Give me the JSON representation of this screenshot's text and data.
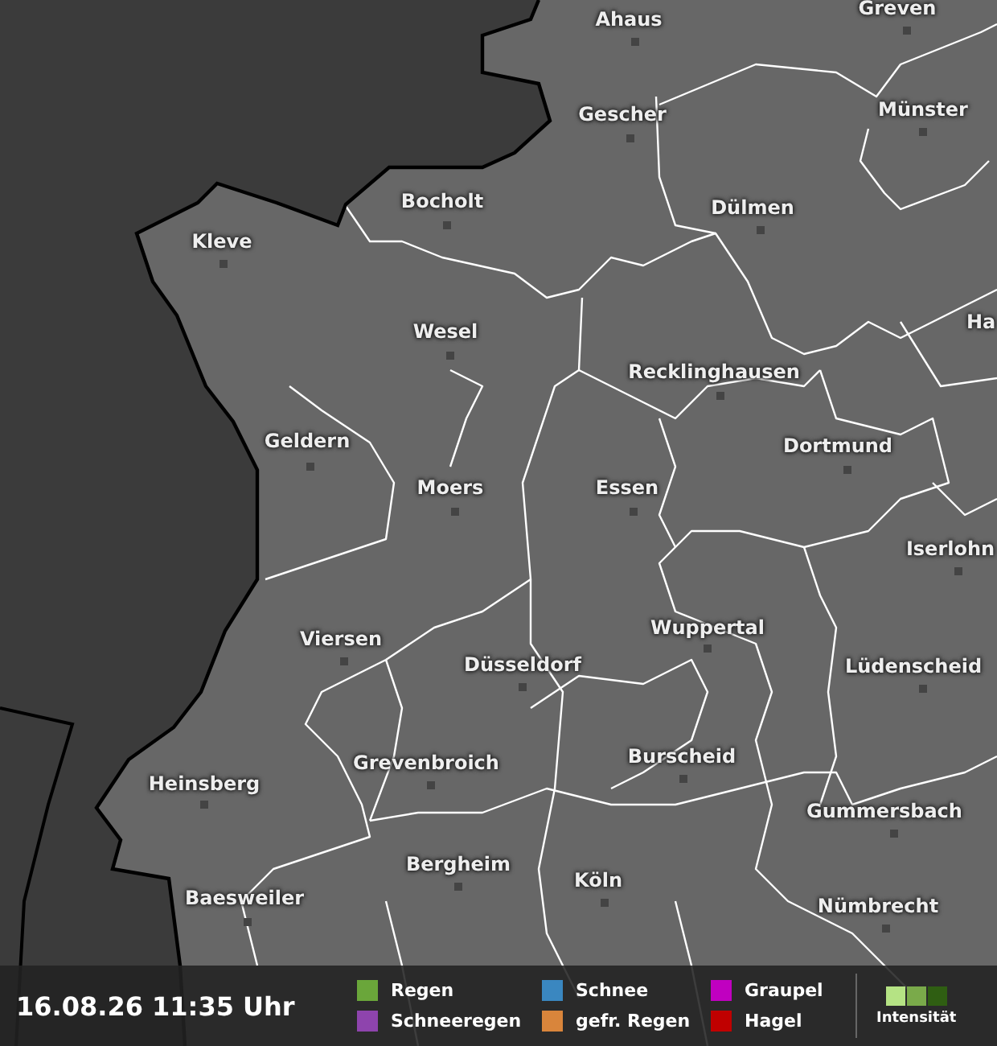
{
  "map": {
    "cities": [
      {
        "name": "Ahaus"
      },
      {
        "name": "Greven"
      },
      {
        "name": "Gescher"
      },
      {
        "name": "Münster"
      },
      {
        "name": "Bocholt"
      },
      {
        "name": "Dülmen"
      },
      {
        "name": "Kleve"
      },
      {
        "name": "Wesel"
      },
      {
        "name": "Ha"
      },
      {
        "name": "Recklinghausen"
      },
      {
        "name": "Geldern"
      },
      {
        "name": "Dortmund"
      },
      {
        "name": "Moers"
      },
      {
        "name": "Essen"
      },
      {
        "name": "Iserlohn"
      },
      {
        "name": "Viersen"
      },
      {
        "name": "Wuppertal"
      },
      {
        "name": "Düsseldorf"
      },
      {
        "name": "Lüdenscheid"
      },
      {
        "name": "Grevenbroich"
      },
      {
        "name": "Burscheid"
      },
      {
        "name": "Heinsberg"
      },
      {
        "name": "Gummersbach"
      },
      {
        "name": "Bergheim"
      },
      {
        "name": "Köln"
      },
      {
        "name": "Baesweiler"
      },
      {
        "name": "Nümbrecht"
      }
    ]
  },
  "timestamp": "16.08.26 11:35 Uhr",
  "legend": [
    {
      "label": "Regen",
      "color": "#6aa63a"
    },
    {
      "label": "Schneeregen",
      "color": "#8e44ad"
    },
    {
      "label": "Schnee",
      "color": "#3a87c0"
    },
    {
      "label": "gefr. Regen",
      "color": "#d9853b"
    },
    {
      "label": "Graupel",
      "color": "#c000c0"
    },
    {
      "label": "Hagel",
      "color": "#c00000"
    }
  ],
  "intensity": {
    "label": "Intensität",
    "steps": [
      {
        "color": "#b5e384"
      },
      {
        "color": "#7aaa4a"
      },
      {
        "color": "#2f5e12"
      }
    ]
  }
}
